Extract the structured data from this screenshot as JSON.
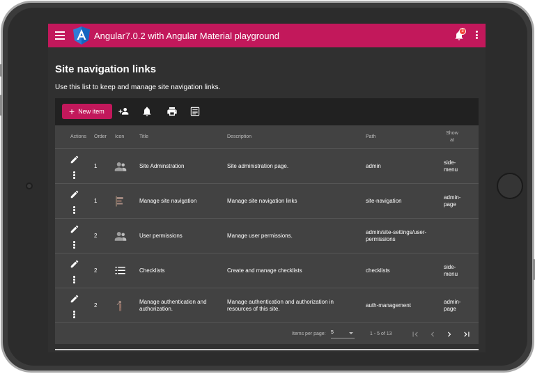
{
  "app": {
    "title": "Angular7.0.2 with Angular Material playground",
    "notification_count": "3"
  },
  "page": {
    "title": "Site navigation links",
    "description": "Use this list to keep and manage site navigation links."
  },
  "actions": {
    "new_item_label": "New item"
  },
  "table": {
    "columns": {
      "actions": "Actions",
      "order": "Order",
      "icon": "Icon",
      "title": "Title",
      "description": "Description",
      "path": "Path",
      "show_at": "Show at"
    },
    "rows": [
      {
        "order": "1",
        "icon": "supervisor-account-icon",
        "title": "Site Adminstration",
        "description": "Site administration page.",
        "path": "admin",
        "show_at": "side-menu"
      },
      {
        "order": "1",
        "icon": "navigation-icon",
        "title": "Manage site navigation",
        "description": "Manage site navigation links",
        "path": "site-navigation",
        "show_at": "admin-page"
      },
      {
        "order": "2",
        "icon": "supervisor-account-icon",
        "title": "User permissions",
        "description": "Manage user permissions.",
        "path": "admin/site-settings/user-permissions",
        "show_at": ""
      },
      {
        "order": "2",
        "icon": "checklist-icon",
        "title": "Checklists",
        "description": "Create and manage checklists",
        "path": "checklists",
        "show_at": "side-menu"
      },
      {
        "order": "2",
        "icon": "authentication-icon",
        "title": "Manage authentication and authorization.",
        "description": "Manage authentication and authorization in resources of this site.",
        "path": "auth-management",
        "show_at": "admin-page"
      }
    ]
  },
  "paginator": {
    "items_per_page_label": "Items per page:",
    "page_size": "5",
    "range_label": "1 - 5 of 13"
  },
  "colors": {
    "primary": "#c2185b",
    "background": "#303030",
    "card": "#424242",
    "action_bar": "#212121"
  }
}
